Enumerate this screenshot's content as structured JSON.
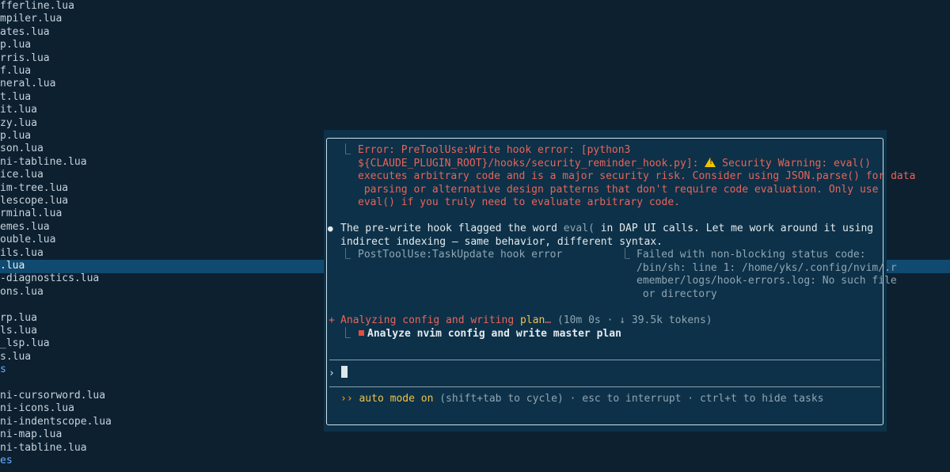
{
  "file_tree": {
    "items": [
      {
        "label": "fferline.lua",
        "type": "file"
      },
      {
        "label": "mpiler.lua",
        "type": "file"
      },
      {
        "label": "ates.lua",
        "type": "file"
      },
      {
        "label": "p.lua",
        "type": "file"
      },
      {
        "label": "rris.lua",
        "type": "file"
      },
      {
        "label": "f.lua",
        "type": "file"
      },
      {
        "label": "neral.lua",
        "type": "file"
      },
      {
        "label": "t.lua",
        "type": "file"
      },
      {
        "label": "it.lua",
        "type": "file"
      },
      {
        "label": "zy.lua",
        "type": "file"
      },
      {
        "label": "p.lua",
        "type": "file"
      },
      {
        "label": "son.lua",
        "type": "file"
      },
      {
        "label": "ni-tabline.lua",
        "type": "file"
      },
      {
        "label": "ice.lua",
        "type": "file"
      },
      {
        "label": "im-tree.lua",
        "type": "file"
      },
      {
        "label": "lescope.lua",
        "type": "file"
      },
      {
        "label": "rminal.lua",
        "type": "file"
      },
      {
        "label": "emes.lua",
        "type": "file"
      },
      {
        "label": "ouble.lua",
        "type": "file"
      },
      {
        "label": "ils.lua",
        "type": "file"
      },
      {
        "label": ".lua",
        "type": "file",
        "selected": true
      },
      {
        "label": "-diagnostics.lua",
        "type": "file"
      },
      {
        "label": "ons.lua",
        "type": "file"
      },
      {
        "label": "",
        "type": "blank"
      },
      {
        "label": "rp.lua",
        "type": "file"
      },
      {
        "label": "ls.lua",
        "type": "file"
      },
      {
        "label": "_lsp.lua",
        "type": "file"
      },
      {
        "label": "s.lua",
        "type": "file"
      },
      {
        "label": "s",
        "type": "dir"
      },
      {
        "label": "",
        "type": "blank"
      },
      {
        "label": "ni-cursorword.lua",
        "type": "file"
      },
      {
        "label": "ni-icons.lua",
        "type": "file"
      },
      {
        "label": "ni-indentscope.lua",
        "type": "file"
      },
      {
        "label": "ni-map.lua",
        "type": "file"
      },
      {
        "label": "ni-tabline.lua",
        "type": "file"
      },
      {
        "label": "es",
        "type": "dir"
      }
    ]
  },
  "popup": {
    "tree_branch": "⎿",
    "error": {
      "line1": "Error: PreToolUse:Write hook error: [python3",
      "line2_a": "${CLAUDE_PLUGIN_ROOT}/hooks/security_reminder_hook.py]: ",
      "line2_b": " Security Warning: eval()",
      "line3": "executes arbitrary code and is a major security risk. Consider using JSON.parse() for data",
      "line4": " parsing or alternative design patterns that don't require code evaluation. Only use",
      "line5": "eval() if you truly need to evaluate arbitrary code."
    },
    "message": {
      "bullet": "●",
      "line1_a": "The pre-write hook flagged the word ",
      "line1_code": "eval(",
      "line1_b": " in DAP UI calls. Let me work around it using",
      "line2": "indirect indexing — same behavior, different syntax."
    },
    "hook": {
      "label": "PostToolUse:TaskUpdate hook error",
      "detail1": "Failed with non-blocking status code:",
      "detail2": "/bin/sh: line 1: /home/yks/.config/nvim/.r",
      "detail3": "emember/logs/hook-errors.log: No such file",
      "detail4": " or directory"
    },
    "status": {
      "spinner": "+",
      "text_a": "Analyzing config and writing ",
      "text_hl": "plan",
      "text_b": "… ",
      "meta": "(10m 0s · ↓ 39.5k tokens)"
    },
    "task": {
      "label": "Analyze nvim config and write master plan"
    },
    "prompt": {
      "symbol": "›",
      "value": ""
    },
    "footer": {
      "arrows": "››",
      "mode": "auto mode on",
      "hint": " (shift+tab to cycle) · esc to interrupt · ctrl+t to hide tasks"
    }
  },
  "colors": {
    "background": "#0c2030",
    "popup_bg": "#0d3148",
    "selected_row": "#104a70",
    "error": "#e8645a",
    "accent_yellow": "#f0c14d",
    "directory": "#6ab0ff"
  }
}
